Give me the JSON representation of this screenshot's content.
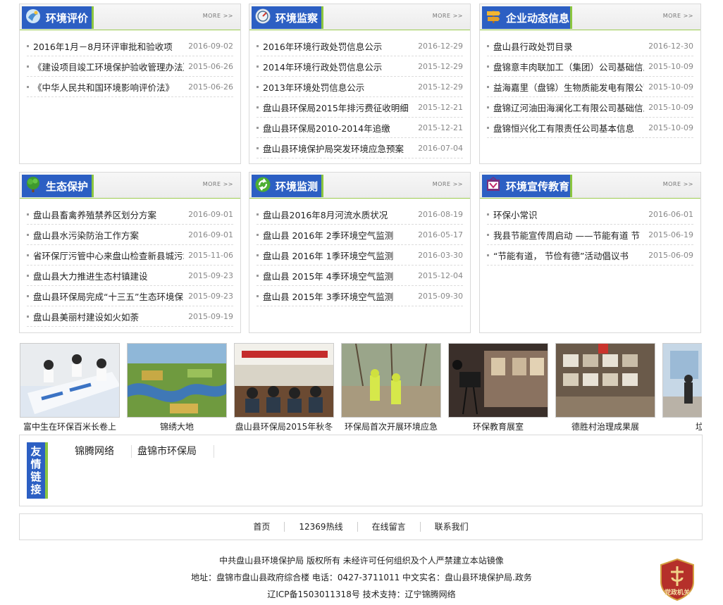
{
  "panels": [
    {
      "title": "环境评价",
      "more": "MORE >>",
      "items": [
        {
          "t": "2016年1月－8月环评审批和验收项",
          "d": "2016-09-02"
        },
        {
          "t": "《建设项目竣工环境保护验收管理办法》",
          "d": "2015-06-26"
        },
        {
          "t": "《中华人民共和国环境影响评价法》",
          "d": "2015-06-26"
        }
      ]
    },
    {
      "title": "环境监察",
      "more": "MORE >>",
      "items": [
        {
          "t": "2016年环境行政处罚信息公示",
          "d": "2016-12-29"
        },
        {
          "t": "2014年环境行政处罚信息公示",
          "d": "2015-12-29"
        },
        {
          "t": "2013年环境处罚信息公示",
          "d": "2015-12-29"
        },
        {
          "t": "盘山县环保局2015年排污费征收明细",
          "d": "2015-12-21"
        },
        {
          "t": "盘山县环保局2010-2014年追缴",
          "d": "2015-12-21"
        },
        {
          "t": "盘山县环境保护局突发环境应急预案",
          "d": "2016-07-04"
        }
      ]
    },
    {
      "title": "企业动态信息",
      "more": "MORE >>",
      "items": [
        {
          "t": "盘山县行政处罚目录",
          "d": "2016-12-30"
        },
        {
          "t": "盘锦意丰肉联加工（集团）公司基础信息",
          "d": "2015-10-09"
        },
        {
          "t": "益海嘉里（盘锦）生物质能发电有限公司",
          "d": "2015-10-09"
        },
        {
          "t": "盘锦辽河油田海澜化工有限公司基础信息",
          "d": "2015-10-09"
        },
        {
          "t": "盘锦恒兴化工有限责任公司基本信息",
          "d": "2015-10-09"
        }
      ]
    },
    {
      "title": "生态保护",
      "more": "MORE >>",
      "items": [
        {
          "t": "盘山县畜禽养殖禁养区划分方案",
          "d": "2016-09-01"
        },
        {
          "t": "盘山县水污染防治工作方案",
          "d": "2016-09-01"
        },
        {
          "t": "省环保厅污管中心来盘山检查新县城污水",
          "d": "2015-11-06"
        },
        {
          "t": "盘山县大力推进生态村镇建设",
          "d": "2015-09-23"
        },
        {
          "t": "盘山县环保局完成“十三五”生态环境保",
          "d": "2015-09-23"
        },
        {
          "t": "盘山县美丽村建设如火如荼",
          "d": "2015-09-19"
        }
      ]
    },
    {
      "title": "环境监测",
      "more": "MORE >>",
      "items": [
        {
          "t": "盘山县2016年8月河流水质状况",
          "d": "2016-08-19"
        },
        {
          "t": "盘山县 2016年 2季环境空气监测",
          "d": "2016-05-17"
        },
        {
          "t": "盘山县 2016年 1季环境空气监测",
          "d": "2016-03-30"
        },
        {
          "t": "盘山县 2015年 4季环境空气监测",
          "d": "2015-12-04"
        },
        {
          "t": "盘山县 2015年 3季环境空气监测",
          "d": "2015-09-30"
        }
      ]
    },
    {
      "title": "环境宣传教育",
      "more": "MORE >>",
      "items": [
        {
          "t": "环保小常识",
          "d": "2016-06-01"
        },
        {
          "t": "我县节能宣传周启动 ——节能有道 节",
          "d": "2015-06-19"
        },
        {
          "t": "“节能有道， 节俭有德”活动倡议书",
          "d": "2015-06-09"
        }
      ]
    }
  ],
  "gallery": [
    "富中生在环保百米长卷上",
    "锦绣大地",
    "盘山县环保局2015年秋冬",
    "环保局首次开展环境应急",
    "环保教育展室",
    "德胜村治理成果展",
    "垃圾分类"
  ],
  "friend_links": {
    "label": "友情链接",
    "items": [
      "锦腾网络",
      "盘锦市环保局"
    ]
  },
  "nav": [
    "首页",
    "12369热线",
    "在线留言",
    "联系我们"
  ],
  "footer": {
    "line1": "中共盘山县环境保护局 版权所有 未经许可任何组织及个人严禁建立本站镜像",
    "line2": "地址：盘锦市盘山县政府综合楼 电话：0427-3711011 中文实名：盘山县环境保护局.政务",
    "line3": "辽ICP备1503011318号 技术支持：辽宁锦腾网络"
  },
  "badge_text": "党政机关",
  "colors": {
    "title_bg": "#2c5fc3",
    "accent_green": "#8bc63f",
    "badge_red": "#b5302a"
  }
}
